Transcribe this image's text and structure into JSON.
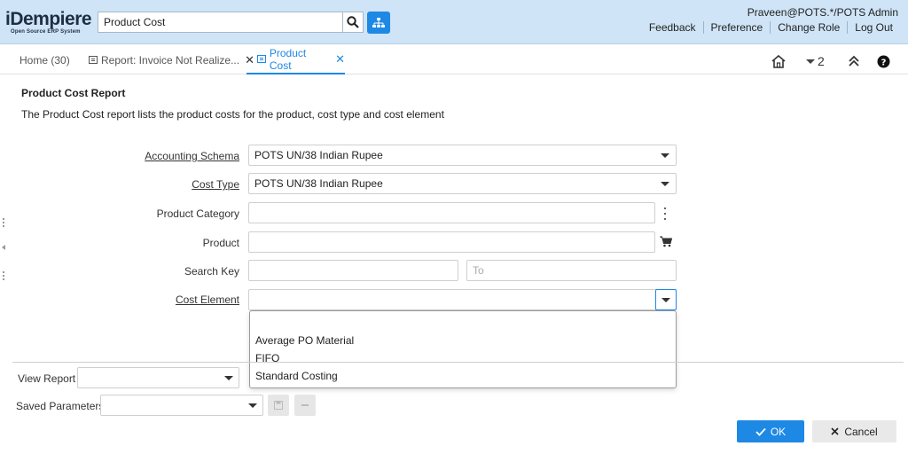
{
  "header": {
    "logo_main": "iDempiere",
    "logo_sub": "Open Source ERP System",
    "search_value": "Product Cost",
    "user": "Praveen@POTS.*/POTS Admin",
    "links": [
      "Feedback",
      "Preference",
      "Change Role",
      "Log Out"
    ]
  },
  "tabs": [
    {
      "label": "Home (30)"
    },
    {
      "label": "Report: Invoice Not Realize..."
    },
    {
      "label": "Product Cost"
    }
  ],
  "toolbar": {
    "count": "2"
  },
  "report": {
    "title": "Product Cost Report",
    "description": "The Product Cost report lists the product costs for the product, cost type and cost element"
  },
  "form": {
    "accounting_schema": {
      "label": "Accounting Schema",
      "value": "POTS UN/38 Indian Rupee"
    },
    "cost_type": {
      "label": "Cost Type",
      "value": "POTS UN/38 Indian Rupee"
    },
    "product_category": {
      "label": "Product Category",
      "value": ""
    },
    "product": {
      "label": "Product",
      "value": ""
    },
    "search_key": {
      "label": "Search Key",
      "value": "",
      "to_placeholder": "To"
    },
    "cost_element": {
      "label": "Cost Element",
      "value": ""
    }
  },
  "cost_element_options": [
    "",
    "Average PO Material",
    "FIFO",
    "Standard Costing"
  ],
  "footer": {
    "view_report_label": "View Report",
    "saved_parameters_label": "Saved Parameters",
    "ok": "OK",
    "cancel": "Cancel"
  },
  "colors": {
    "accent": "#1e88e5",
    "header_bg": "#cfe4f6"
  }
}
